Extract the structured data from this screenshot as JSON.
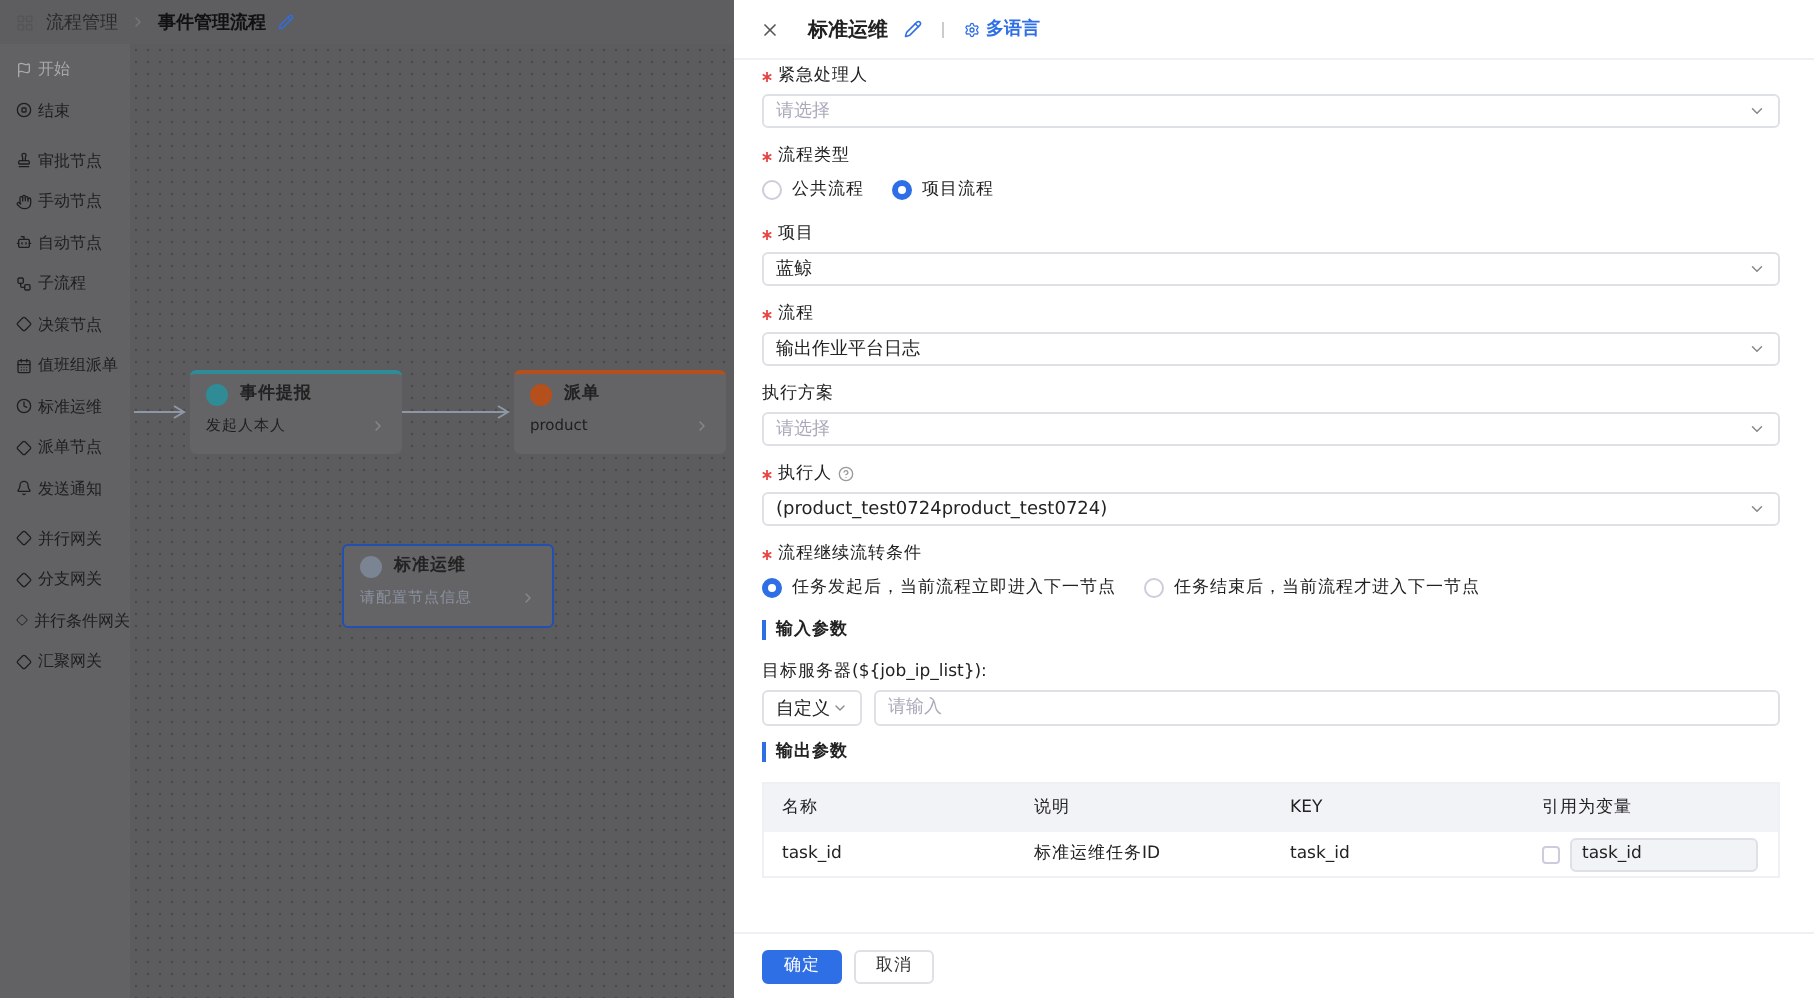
{
  "breadcrumb": {
    "parent": "流程管理",
    "current": "事件管理流程"
  },
  "palette": [
    [
      {
        "label": "开始",
        "disabled": true
      },
      {
        "label": "结束",
        "disabled": false
      }
    ],
    [
      {
        "label": "审批节点",
        "disabled": false
      },
      {
        "label": "手动节点",
        "disabled": false
      },
      {
        "label": "自动节点",
        "disabled": false
      },
      {
        "label": "子流程",
        "disabled": false
      },
      {
        "label": "决策节点",
        "disabled": false
      },
      {
        "label": "值班组派单",
        "disabled": false
      },
      {
        "label": "标准运维",
        "disabled": false
      },
      {
        "label": "派单节点",
        "disabled": false
      },
      {
        "label": "发送通知",
        "disabled": false
      }
    ],
    [
      {
        "label": "并行网关",
        "disabled": false
      },
      {
        "label": "分支网关",
        "disabled": false
      },
      {
        "label": "并行条件网关",
        "disabled": false
      },
      {
        "label": "汇聚网关",
        "disabled": false
      }
    ]
  ],
  "canvas": {
    "nodes": [
      {
        "title": "事件提报",
        "subtitle": "发起人本人",
        "selected": false,
        "color": "#2f8c96"
      },
      {
        "title": "派单",
        "subtitle": "product",
        "selected": false,
        "color": "#b5501c"
      },
      {
        "title": "标准运维",
        "subtitle": "请配置节点信息",
        "selected": true,
        "color": "#7a8492"
      }
    ]
  },
  "drawer": {
    "title": "标准运维",
    "multilang": "多语言",
    "fields": [
      {
        "kind": "select",
        "label": "紧急处理人",
        "required": true,
        "placeholder": "请选择"
      },
      {
        "kind": "radio",
        "label": "流程类型",
        "required": true,
        "options": [
          {
            "label": "公共流程",
            "selected": false
          },
          {
            "label": "项目流程",
            "selected": true
          }
        ]
      },
      {
        "kind": "select",
        "label": "项目",
        "required": true,
        "value": "蓝鲸"
      },
      {
        "kind": "select",
        "label": "流程",
        "required": true,
        "value": "输出作业平台日志"
      },
      {
        "kind": "select",
        "label": "执行方案",
        "required": false,
        "placeholder": "请选择"
      },
      {
        "kind": "select",
        "label": "执行人",
        "required": true,
        "help": true,
        "value": "(product_test0724product_test0724)"
      },
      {
        "kind": "radio",
        "label": "流程继续流转条件",
        "required": true,
        "options": [
          {
            "label": "任务发起后，当前流程立即进入下一节点",
            "selected": true
          },
          {
            "label": "任务结束后，当前流程才进入下一节点",
            "selected": false
          }
        ]
      },
      {
        "kind": "section",
        "label": "输入参数"
      },
      {
        "kind": "combo",
        "label": "目标服务器(${job_ip_list}):",
        "select_value": "自定义",
        "placeholder": "请输入"
      },
      {
        "kind": "section",
        "label": "输出参数"
      },
      {
        "kind": "table",
        "columns": [
          "名称",
          "说明",
          "KEY",
          "引用为变量"
        ],
        "rows": [
          {
            "cells": [
              "task_id",
              "标准运维任务ID",
              "task_id"
            ],
            "checked": false,
            "variable": "task_id"
          }
        ]
      }
    ],
    "buttons": [
      {
        "label": "确定",
        "kind": "primary"
      },
      {
        "label": "取消",
        "kind": "default"
      }
    ]
  }
}
